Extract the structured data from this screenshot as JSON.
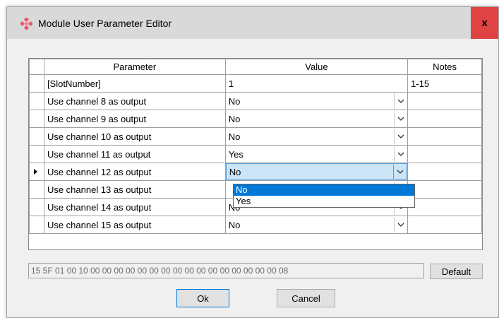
{
  "window": {
    "title": "Module User Parameter Editor",
    "close_label": "x"
  },
  "grid": {
    "columns": [
      "Parameter",
      "Value",
      "Notes"
    ],
    "rows": [
      {
        "parameter": "[SlotNumber]",
        "value": "1",
        "notes": "1-15",
        "combo": false
      },
      {
        "parameter": "Use channel 8 as output",
        "value": "No",
        "notes": "",
        "combo": true
      },
      {
        "parameter": "Use channel 9 as output",
        "value": "No",
        "notes": "",
        "combo": true
      },
      {
        "parameter": "Use channel 10 as output",
        "value": "No",
        "notes": "",
        "combo": true
      },
      {
        "parameter": "Use channel 11 as output",
        "value": "Yes",
        "notes": "",
        "combo": true
      },
      {
        "parameter": "Use channel 12 as output",
        "value": "No",
        "notes": "",
        "combo": true
      },
      {
        "parameter": "Use channel 13 as output",
        "value": "",
        "notes": "",
        "combo": true
      },
      {
        "parameter": "Use channel 14 as output",
        "value": "No",
        "notes": "",
        "combo": true
      },
      {
        "parameter": "Use channel 15 as output",
        "value": "No",
        "notes": "",
        "combo": true
      }
    ],
    "active_row_index": 5,
    "dropdown_options": [
      "No",
      "Yes"
    ],
    "dropdown_selected": "No"
  },
  "hex_string": "15 5F 01 00 10 00 00 00 00 00 00 00 00 00 00 00 00 00 00 00 00 08",
  "buttons": {
    "default_label": "Default",
    "ok_label": "Ok",
    "cancel_label": "Cancel"
  },
  "colors": {
    "close_button": "#e04343",
    "selection": "#0078d7",
    "active_cell": "#cce4f7",
    "app_icon": "#e8556a"
  }
}
